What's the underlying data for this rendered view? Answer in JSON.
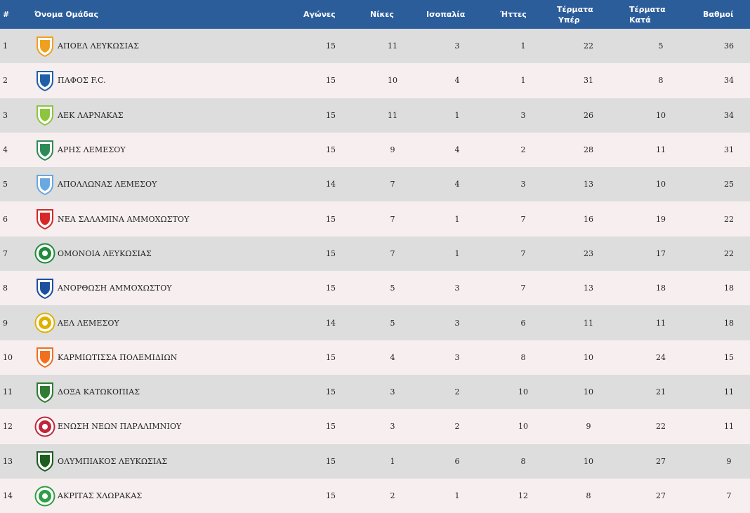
{
  "columns": {
    "rank": "#",
    "team": "Όνομα Ομάδας",
    "played": "Αγώνες",
    "wins": "Νίκες",
    "draws": "Ισοπαλία",
    "losses": "Ήττες",
    "goals_for_1": "Τέρματα",
    "goals_for_2": "Υπέρ",
    "goals_against_1": "Τέρματα",
    "goals_against_2": "Κατά",
    "points": "Βαθμοί"
  },
  "rows": [
    {
      "rank": "1",
      "team": "ΑΠΟΕΛ ΛΕΥΚΩΣΙΑΣ",
      "played": "15",
      "wins": "11",
      "draws": "3",
      "losses": "1",
      "gf": "22",
      "ga": "5",
      "pts": "36",
      "logo": "apoel-crest-icon",
      "color": "#f0a020"
    },
    {
      "rank": "2",
      "team": "ΠΑΦΟΣ F.C.",
      "played": "15",
      "wins": "10",
      "draws": "4",
      "losses": "1",
      "gf": "31",
      "ga": "8",
      "pts": "34",
      "logo": "pafos-crest-icon",
      "color": "#1f5fa8"
    },
    {
      "rank": "3",
      "team": "ΑΕΚ ΛΑΡΝΑΚΑΣ",
      "played": "15",
      "wins": "11",
      "draws": "1",
      "losses": "3",
      "gf": "26",
      "ga": "10",
      "pts": "34",
      "logo": "aek-crest-icon",
      "color": "#8cc63f"
    },
    {
      "rank": "4",
      "team": "ΑΡΗΣ ΛΕΜΕΣΟΥ",
      "played": "15",
      "wins": "9",
      "draws": "4",
      "losses": "2",
      "gf": "28",
      "ga": "11",
      "pts": "31",
      "logo": "aris-crest-icon",
      "color": "#2e8b57"
    },
    {
      "rank": "5",
      "team": "ΑΠΟΛΛΩΝΑΣ ΛΕΜΕΣΟΥ",
      "played": "14",
      "wins": "7",
      "draws": "4",
      "losses": "3",
      "gf": "13",
      "ga": "10",
      "pts": "25",
      "logo": "apollon-crest-icon",
      "color": "#6aa8e0"
    },
    {
      "rank": "6",
      "team": "ΝΕΑ ΣΑΛΑΜΙΝΑ ΑΜΜΟΧΩΣΤΟΥ",
      "played": "15",
      "wins": "7",
      "draws": "1",
      "losses": "7",
      "gf": "16",
      "ga": "19",
      "pts": "22",
      "logo": "nea-salamina-crest-icon",
      "color": "#d62828"
    },
    {
      "rank": "7",
      "team": "ΟΜΟΝΟΙΑ ΛΕΥΚΩΣΙΑΣ",
      "played": "15",
      "wins": "7",
      "draws": "1",
      "losses": "7",
      "gf": "23",
      "ga": "17",
      "pts": "22",
      "logo": "omonoia-crest-icon",
      "color": "#1f8a3a"
    },
    {
      "rank": "8",
      "team": "ΑΝΟΡΘΩΣΗ ΑΜΜΟΧΩΣΤΟΥ",
      "played": "15",
      "wins": "5",
      "draws": "3",
      "losses": "7",
      "gf": "13",
      "ga": "18",
      "pts": "18",
      "logo": "anorthosis-crest-icon",
      "color": "#1d4fa0"
    },
    {
      "rank": "9",
      "team": "ΑΕΛ ΛΕΜΕΣΟΥ",
      "played": "14",
      "wins": "5",
      "draws": "3",
      "losses": "6",
      "gf": "11",
      "ga": "11",
      "pts": "18",
      "logo": "ael-crest-icon",
      "color": "#e0b000"
    },
    {
      "rank": "10",
      "team": "ΚΑΡΜΙΩΤΙΣΣΑ ΠΟΛΕΜΙΔΙΩΝ",
      "played": "15",
      "wins": "4",
      "draws": "3",
      "losses": "8",
      "gf": "10",
      "ga": "24",
      "pts": "15",
      "logo": "karmiotissa-crest-icon",
      "color": "#f07020"
    },
    {
      "rank": "11",
      "team": "ΔΟΞΑ ΚΑΤΩΚΟΠΙΑΣ",
      "played": "15",
      "wins": "3",
      "draws": "2",
      "losses": "10",
      "gf": "10",
      "ga": "21",
      "pts": "11",
      "logo": "doxa-crest-icon",
      "color": "#2e7d32"
    },
    {
      "rank": "12",
      "team": "ΕΝΩΣΗ ΝΕΩΝ ΠΑΡΑΛΙΜΝΙΟΥ",
      "played": "15",
      "wins": "3",
      "draws": "2",
      "losses": "10",
      "gf": "9",
      "ga": "22",
      "pts": "11",
      "logo": "enp-crest-icon",
      "color": "#c0263a"
    },
    {
      "rank": "13",
      "team": "ΟΛΥΜΠΙΑΚΟΣ ΛΕΥΚΩΣΙΑΣ",
      "played": "15",
      "wins": "1",
      "draws": "6",
      "losses": "8",
      "gf": "10",
      "ga": "27",
      "pts": "9",
      "logo": "olympiakos-crest-icon",
      "color": "#1b5e20"
    },
    {
      "rank": "14",
      "team": "ΑΚΡΙΤΑΣ ΧΛΩΡΑΚΑΣ",
      "played": "15",
      "wins": "2",
      "draws": "1",
      "losses": "12",
      "gf": "8",
      "ga": "27",
      "pts": "7",
      "logo": "akritas-crest-icon",
      "color": "#2f9e44"
    }
  ]
}
